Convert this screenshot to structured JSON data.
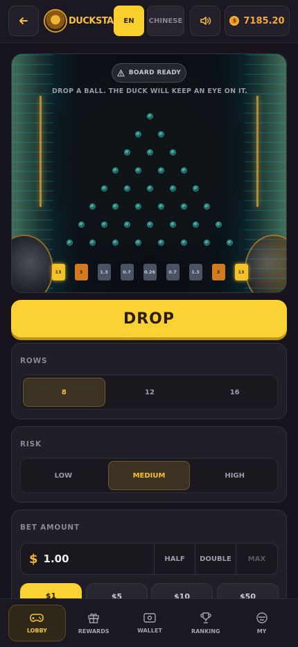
{
  "header": {
    "logo_text": "DUCKSTAKE",
    "lang_en": "EN",
    "lang_cn": "CHINESE",
    "balance": "7185.20",
    "coin_symbol": "$"
  },
  "board": {
    "status": "BOARD READY",
    "hint": "DROP A BALL. THE DUCK WILL KEEP AN EYE ON IT.",
    "rows": 8,
    "multipliers": [
      "13",
      "3",
      "1.3",
      "0.7",
      "0.26",
      "0.7",
      "1.3",
      "3",
      "13"
    ]
  },
  "drop_label": "DROP",
  "rows_panel": {
    "title": "ROWS",
    "options": [
      "8",
      "12",
      "16"
    ],
    "selected": "8"
  },
  "risk_panel": {
    "title": "RISK",
    "options": [
      "LOW",
      "MEDIUM",
      "HIGH"
    ],
    "selected": "MEDIUM"
  },
  "bet_panel": {
    "title": "BET AMOUNT",
    "currency": "$",
    "value": "1.00",
    "half": "HALF",
    "double": "DOUBLE",
    "max": "MAX",
    "chips": [
      "$1",
      "$5",
      "$10",
      "$50"
    ]
  },
  "nav": [
    {
      "label": "LOBBY",
      "icon": "gamepad-icon"
    },
    {
      "label": "REWARDS",
      "icon": "gift-icon"
    },
    {
      "label": "WALLET",
      "icon": "wallet-icon"
    },
    {
      "label": "RANKING",
      "icon": "trophy-icon"
    },
    {
      "label": "MY",
      "icon": "profile-icon"
    }
  ],
  "colors": {
    "accent": "#fbd233",
    "background": "#17141d",
    "panel": "#211e28"
  }
}
